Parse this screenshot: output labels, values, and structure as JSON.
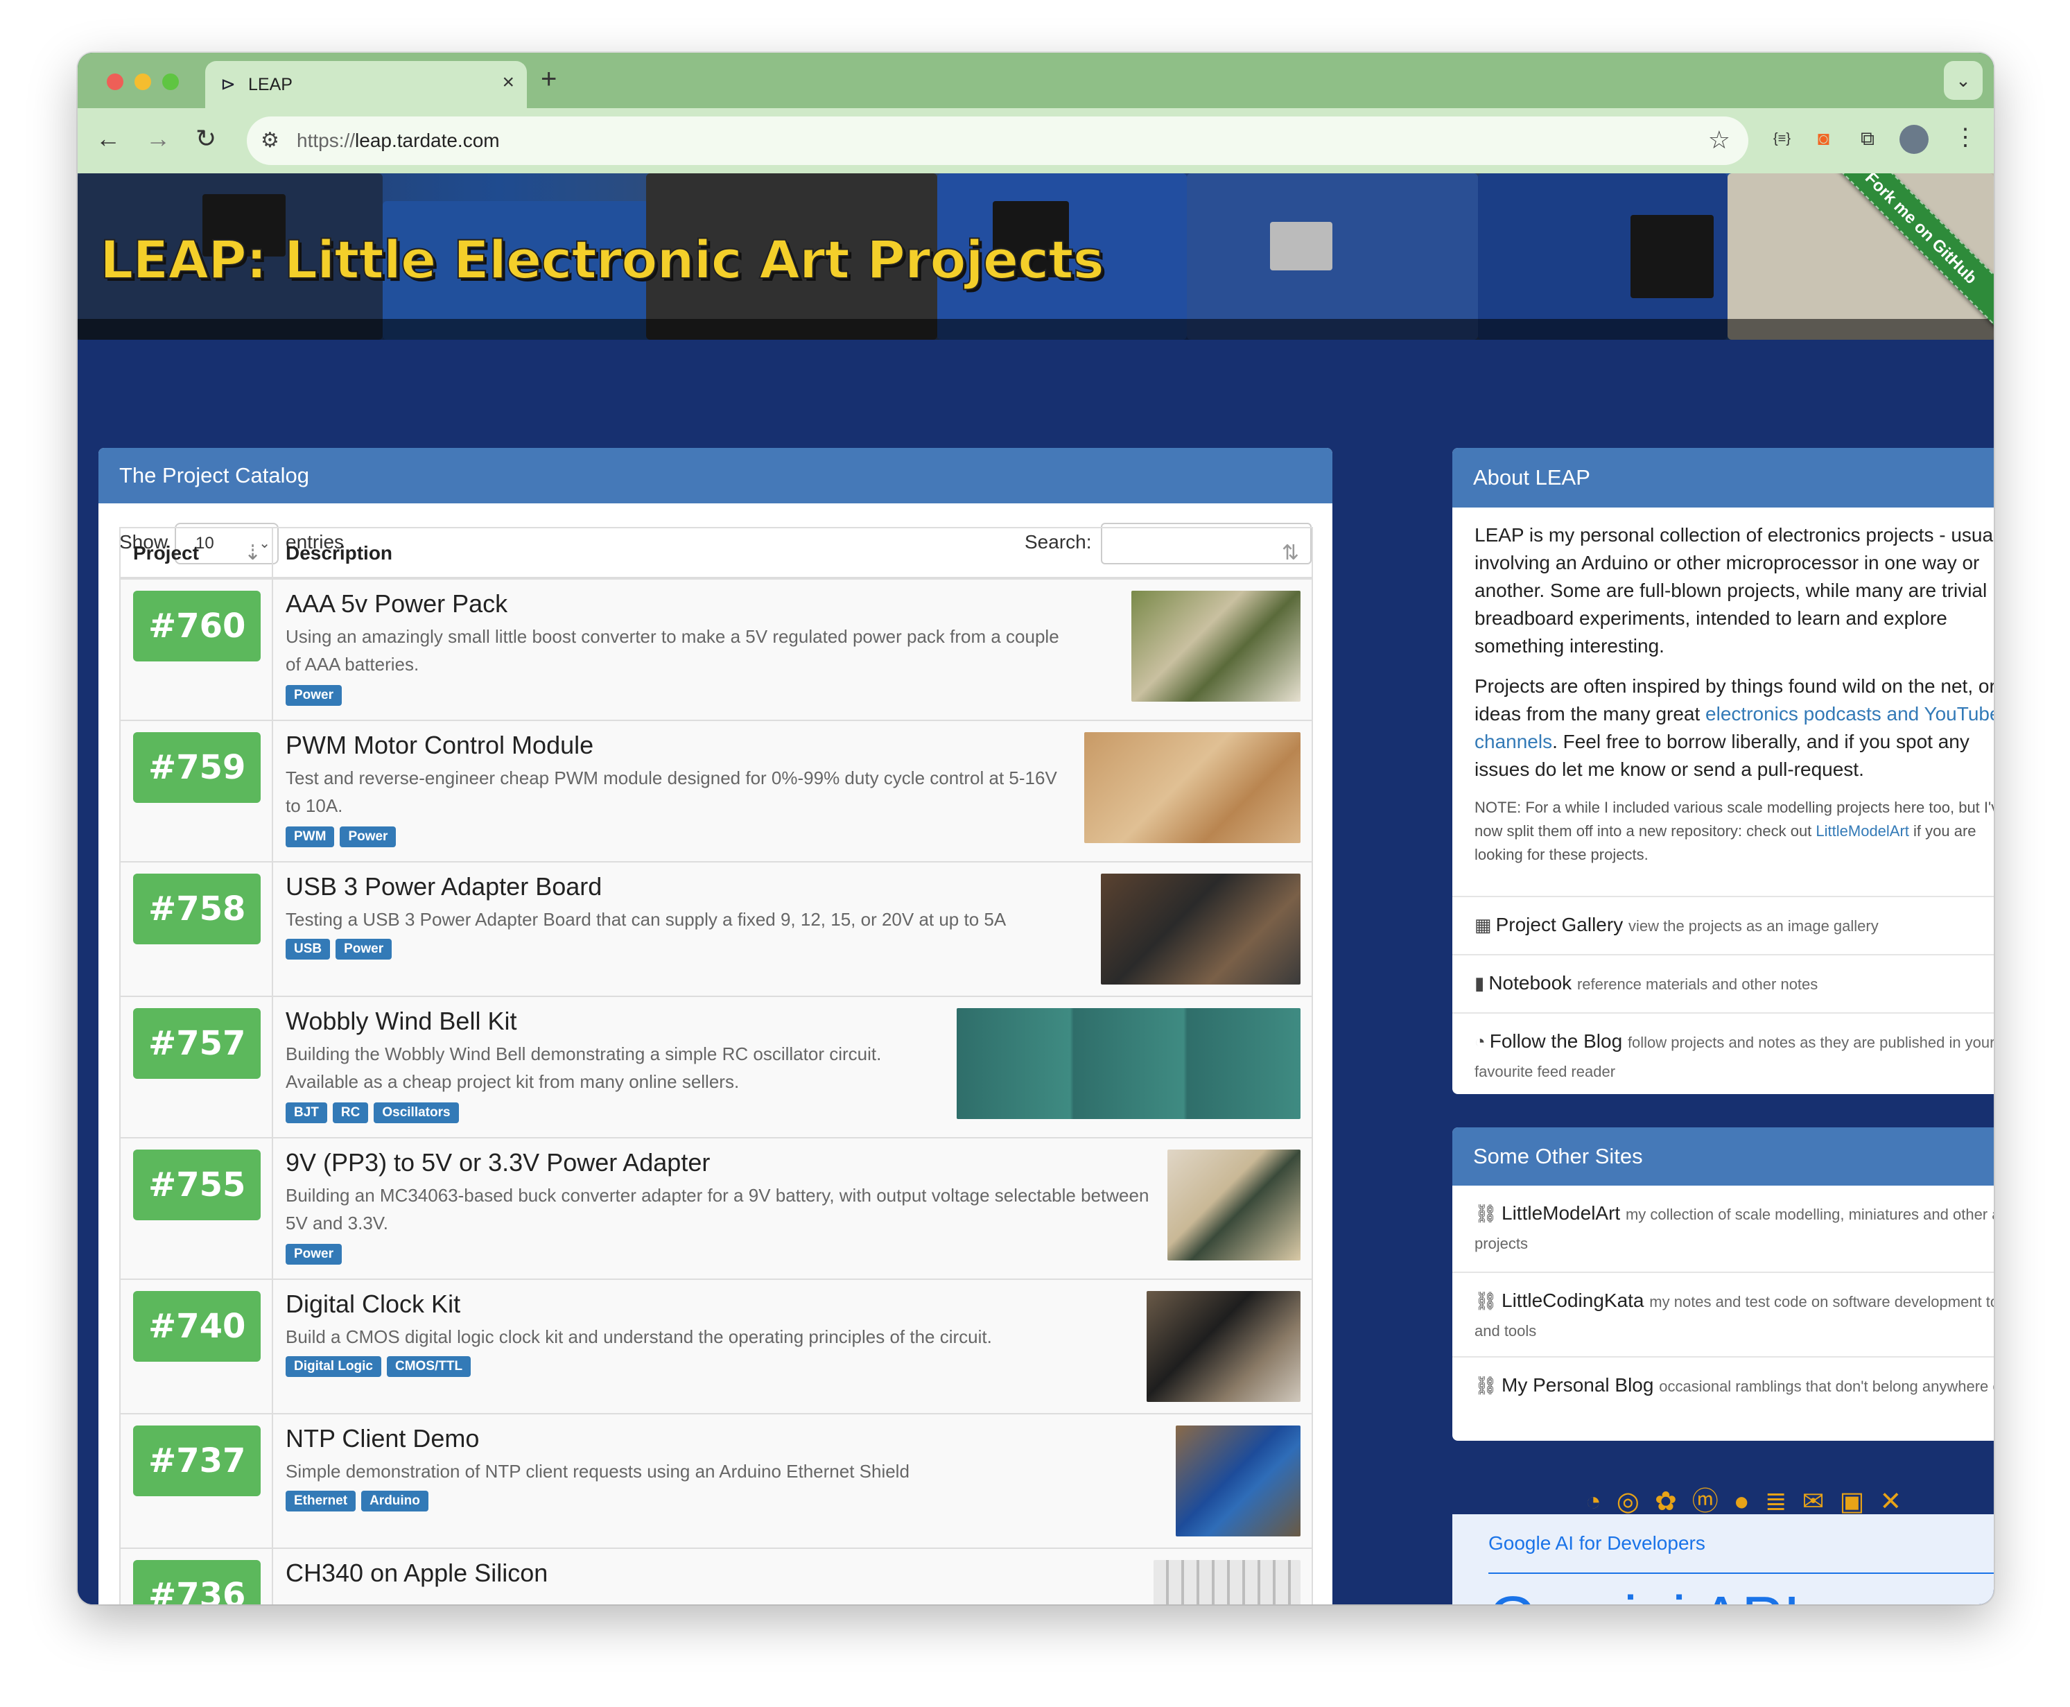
{
  "browser": {
    "tab_title": "LEAP",
    "tab_favicon": "diode-icon",
    "url_scheme": "https://",
    "url_host": "leap.tardate.com"
  },
  "banner": {
    "title": "LEAP: Little Electronic Art Projects",
    "ribbon": "Fork me on GitHub"
  },
  "catalog": {
    "heading": "The Project Catalog",
    "show_label": "Show",
    "page_length": "10",
    "entries_label": "entries",
    "search_label": "Search:",
    "col_project": "Project",
    "col_description": "Description",
    "rows": [
      {
        "num": "#760",
        "title": "AAA 5v Power Pack",
        "desc": "Using an amazingly small little boost converter to make a 5V regulated power pack from a couple of AAA batteries.",
        "tags": [
          "Power"
        ]
      },
      {
        "num": "#759",
        "title": "PWM Motor Control Module",
        "desc": "Test and reverse-engineer cheap PWM module designed for 0%-99% duty cycle control at 5-16V to 10A.",
        "tags": [
          "PWM",
          "Power"
        ]
      },
      {
        "num": "#758",
        "title": "USB 3 Power Adapter Board",
        "desc": "Testing a USB 3 Power Adapter Board that can supply a fixed 9, 12, 15, or 20V at up to 5A",
        "tags": [
          "USB",
          "Power"
        ]
      },
      {
        "num": "#757",
        "title": "Wobbly Wind Bell Kit",
        "desc": "Building the Wobbly Wind Bell demonstrating a simple RC oscillator circuit. Available as a cheap project kit from many online sellers.",
        "tags": [
          "BJT",
          "RC",
          "Oscillators"
        ]
      },
      {
        "num": "#755",
        "title": "9V (PP3) to 5V or 3.3V Power Adapter",
        "desc": "Building an MC34063-based buck converter adapter for a 9V battery, with output voltage selectable between 5V and 3.3V.",
        "tags": [
          "Power"
        ]
      },
      {
        "num": "#740",
        "title": "Digital Clock Kit",
        "desc": "Build a CMOS digital logic clock kit and understand the operating principles of the circuit.",
        "tags": [
          "Digital Logic",
          "CMOS/TTL"
        ]
      },
      {
        "num": "#737",
        "title": "NTP Client Demo",
        "desc": "Simple demonstration of NTP client requests using an Arduino Ethernet Shield",
        "tags": [
          "Ethernet",
          "Arduino"
        ]
      },
      {
        "num": "#736",
        "title": "CH340 on Apple Silicon",
        "desc": "",
        "tags": []
      }
    ]
  },
  "about": {
    "heading": "About LEAP",
    "p1": "LEAP is my personal collection of electronics projects - usually involving an Arduino or other microprocessor in one way or another. Some are full-blown projects, while many are trivial breadboard experiments, intended to learn and explore something interesting.",
    "p2_before": "Projects are often inspired by things found wild on the net, or ideas from the many great ",
    "p2_link": "electronics podcasts and YouTube channels",
    "p2_after": ". Feel free to borrow liberally, and if you spot any issues do let me know or send a pull-request.",
    "note_before": "NOTE: For a while I included various scale modelling projects here too, but I've now split them off into a new repository: check out ",
    "note_link": "LittleModelArt",
    "note_after": " if you are looking for these projects.",
    "links": [
      {
        "icon": "gallery-icon",
        "label": "Project Gallery",
        "sub": "view the projects as an image gallery"
      },
      {
        "icon": "notebook-icon",
        "label": "Notebook",
        "sub": "reference materials and other notes"
      },
      {
        "icon": "rss-icon",
        "label": "Follow the Blog",
        "sub": "follow projects and notes as they are published in your favourite feed reader"
      }
    ]
  },
  "others": {
    "heading": "Some Other Sites",
    "links": [
      {
        "label": "LittleModelArt",
        "sub": "my collection of scale modelling, miniatures and other art projects"
      },
      {
        "label": "LittleCodingKata",
        "sub": "my notes and test code on software development topics and tools"
      },
      {
        "label": "My Personal Blog",
        "sub": "occasional ramblings that don't belong anywhere else"
      }
    ]
  },
  "social_icons": [
    "rss-icon",
    "instagram-icon",
    "bluesky-icon",
    "mastodon-icon",
    "github-icon",
    "stackoverflow-icon",
    "email-icon",
    "linkedin-icon",
    "x-icon"
  ],
  "ad": {
    "link": "Google AI for Developers",
    "big": "Gemini API"
  },
  "colors": {
    "page_background": "#173070",
    "panel_header": "#4579b8",
    "project_badge": "#5cb85c",
    "tag": "#337ab7",
    "banner_title": "#f4cf2a"
  }
}
